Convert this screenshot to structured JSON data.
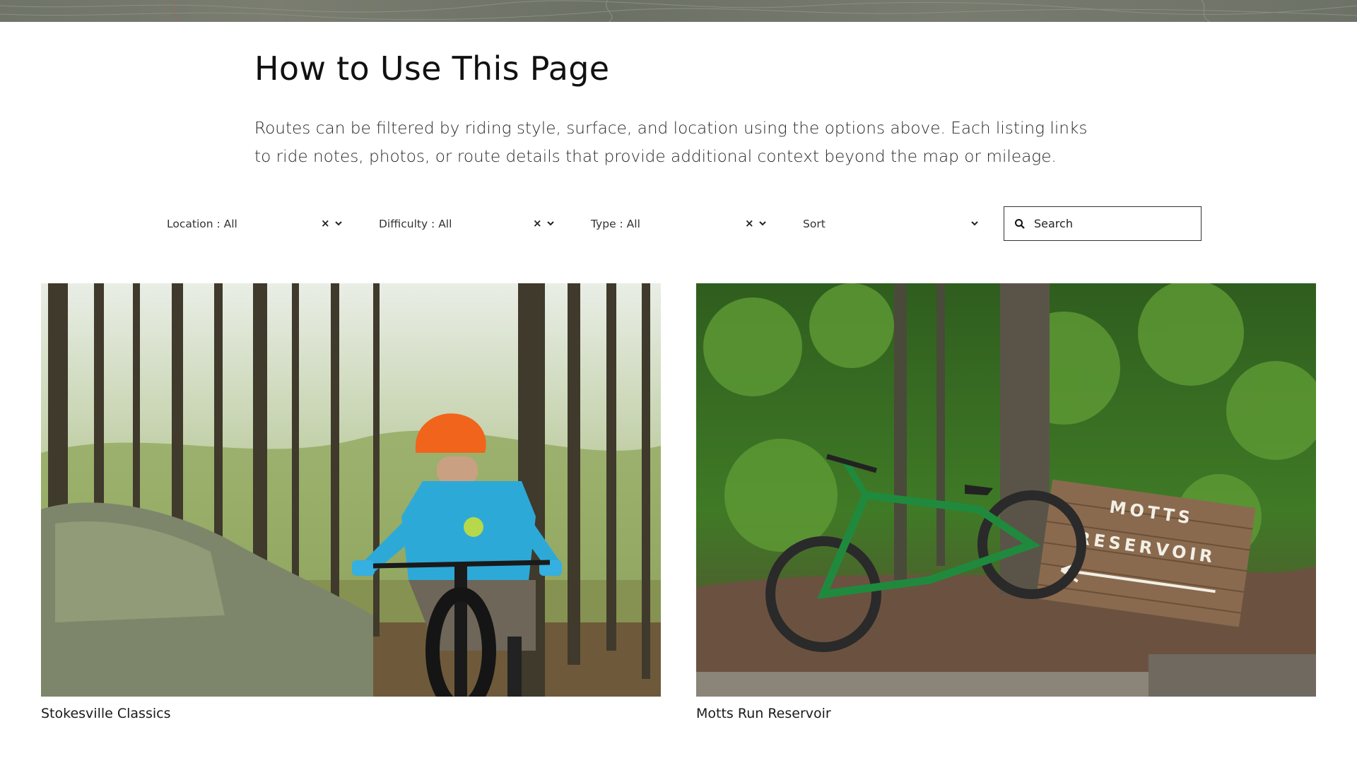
{
  "header": {
    "title": "How to Use This Page",
    "intro": "Routes can be filtered by riding style, surface, and location using the options above. Each listing links to ride notes, photos, or route details that provide additional context beyond the map or mileage."
  },
  "filters": [
    {
      "label": "Location : All",
      "clear_icon": "×"
    },
    {
      "label": "Difficulty : All",
      "clear_icon": "×"
    },
    {
      "label": "Type : All",
      "clear_icon": "×"
    },
    {
      "label": "Sort",
      "clear_icon": ""
    }
  ],
  "search": {
    "placeholder": "Search"
  },
  "cards": [
    {
      "caption": "Stokesville Classics",
      "photo_subject": "mountain biker in orange helmet on forest trail beside mossy rocks"
    },
    {
      "caption": "Motts Run Reservoir",
      "photo_subject": "green mountain bike leaning on tree beside wooden trail sign",
      "sign_line_1": "MOTTS",
      "sign_line_2": "RESERVOIR"
    }
  ],
  "colors": {
    "map_strip": "#72766b",
    "text": "#111111",
    "search_border": "#333333"
  }
}
